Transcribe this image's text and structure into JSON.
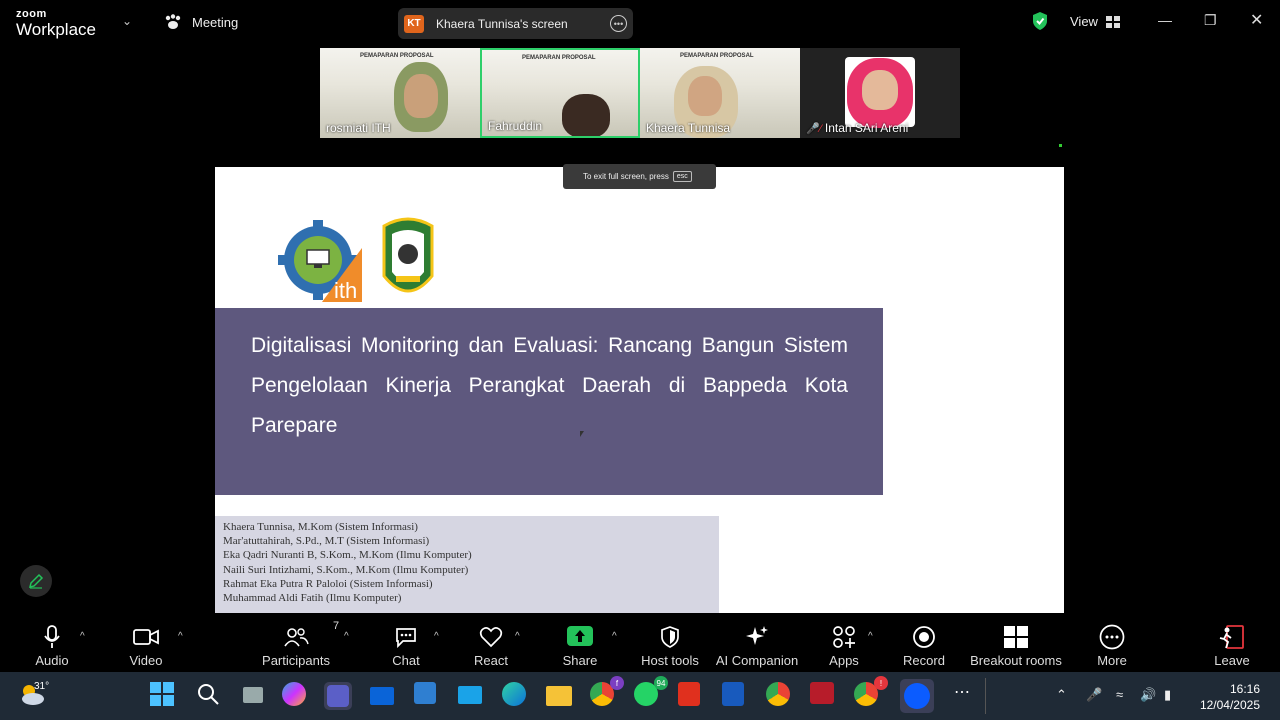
{
  "brand": {
    "line1": "zoom",
    "line2": "Workplace"
  },
  "meeting_label": "Meeting",
  "share_pill": {
    "initials": "KT",
    "title": "Khaera Tunnisa's screen"
  },
  "view_label": "View",
  "participants_strip": [
    {
      "name": "rosmiati ITH",
      "slide_text": "PEMAPARAN PROPOSAL"
    },
    {
      "name": "Fahruddin",
      "slide_text": "PEMAPARAN PROPOSAL"
    },
    {
      "name": "Khaera Tunnisa",
      "slide_text": "PEMAPARAN PROPOSAL"
    },
    {
      "name": "Intan SAri Areni",
      "slide_text": ""
    }
  ],
  "fullscreen_hint": {
    "text": "To exit full screen, press",
    "key": "esc"
  },
  "slide": {
    "title": "Digitalisasi Monitoring dan Evaluasi: Rancang Bangun Sistem Pengelolaan Kinerja Perangkat Daerah di Bappeda Kota Parepare",
    "authors": [
      "Khaera Tunnisa, M.Kom (Sistem Informasi)",
      "Mar'atuttahirah, S.Pd., M.T (Sistem Informasi)",
      "Eka Qadri Nuranti B, S.Kom., M.Kom (Ilmu Komputer)",
      "Naili Suri Intizhami, S.Kom., M.Kom (Ilmu Komputer)",
      "Rahmat Eka Putra R Paloloi (Sistem Informasi)",
      "Muhammad Aldi Fatih (Ilmu Komputer)"
    ],
    "logo1_text": "ith"
  },
  "toolbar": {
    "audio": "Audio",
    "video": "Video",
    "participants": "Participants",
    "participants_count": "7",
    "chat": "Chat",
    "react": "React",
    "share": "Share",
    "host_tools": "Host tools",
    "ai_companion": "AI Companion",
    "apps": "Apps",
    "record": "Record",
    "breakout_rooms": "Breakout rooms",
    "more": "More",
    "leave": "Leave"
  },
  "taskbar": {
    "weather": "31°",
    "badge_chrome": "f",
    "badge_whatsapp": "94",
    "badge_chrome2": "!",
    "time": "16:16",
    "date": "12/04/2025"
  },
  "colors": {
    "title_band": "#5e587e",
    "active_speaker": "#2ecf6a",
    "share_green": "#23c25a",
    "leave_red": "#e5363d"
  }
}
